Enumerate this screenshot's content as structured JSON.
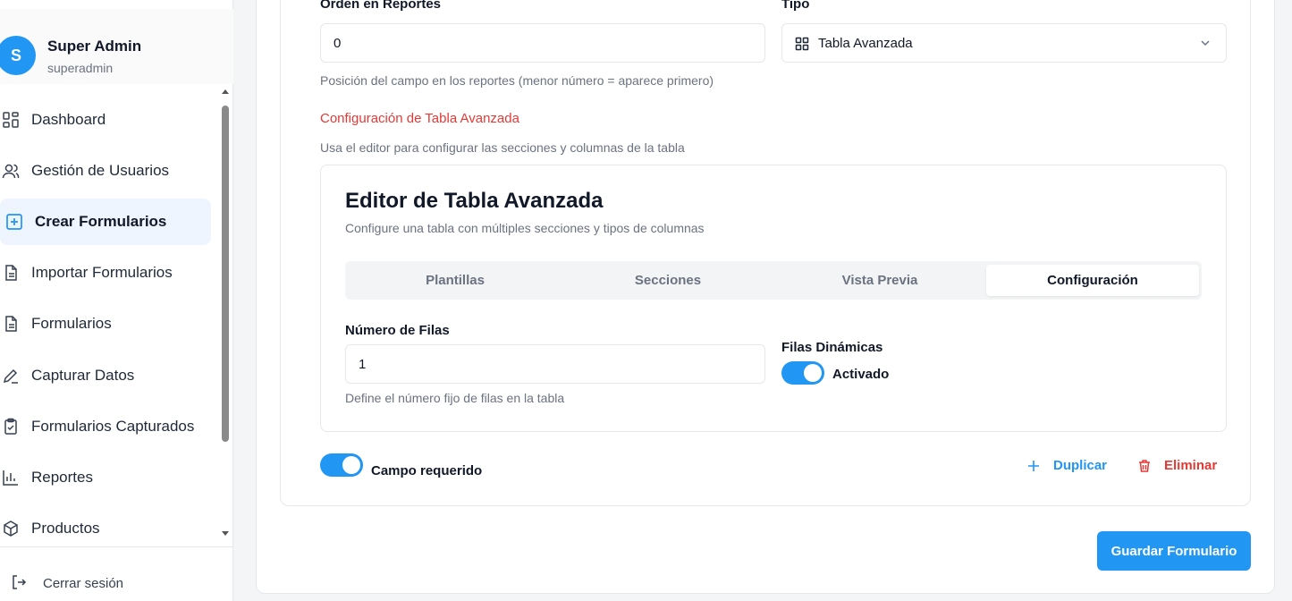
{
  "user": {
    "initial": "S",
    "name": "Super Admin",
    "handle": "superadmin"
  },
  "sidebar": {
    "items": [
      {
        "label": "Dashboard",
        "icon": "dashboard-icon"
      },
      {
        "label": "Gestión de Usuarios",
        "icon": "users-icon"
      },
      {
        "label": "Crear Formularios",
        "icon": "plus-square-icon",
        "active": true
      },
      {
        "label": "Importar Formularios",
        "icon": "file-icon"
      },
      {
        "label": "Formularios",
        "icon": "file-icon"
      },
      {
        "label": "Capturar Datos",
        "icon": "pencil-icon"
      },
      {
        "label": "Formularios Capturados",
        "icon": "clipboard-check-icon"
      },
      {
        "label": "Reportes",
        "icon": "bar-chart-icon"
      },
      {
        "label": "Productos",
        "icon": "box-icon"
      }
    ],
    "logout_label": "Cerrar sesión"
  },
  "field": {
    "order_label": "Orden en Reportes",
    "order_value": "0",
    "order_help": "Posición del campo en los reportes (menor número = aparece primero)",
    "type_label": "Tipo",
    "type_value": "Tabla Avanzada",
    "config_title": "Configuración de Tabla Avanzada",
    "config_help": "Usa el editor para configurar las secciones y columnas de la tabla",
    "required_label": "Campo requerido",
    "duplicate_label": "Duplicar",
    "delete_label": "Eliminar"
  },
  "editor": {
    "title": "Editor de Tabla Avanzada",
    "subtitle": "Configure una tabla con múltiples secciones y tipos de columnas",
    "tabs": [
      "Plantillas",
      "Secciones",
      "Vista Previa",
      "Configuración"
    ],
    "active_tab": "Configuración",
    "rows_label": "Número de Filas",
    "rows_value": "1",
    "rows_help": "Define el número fijo de filas en la tabla",
    "dynamic_label": "Filas Dinámicas",
    "dynamic_state": "Activado",
    "dynamic_on": true
  },
  "save_label": "Guardar Formulario",
  "colors": {
    "primary": "#2196f3",
    "danger": "#e53935"
  }
}
